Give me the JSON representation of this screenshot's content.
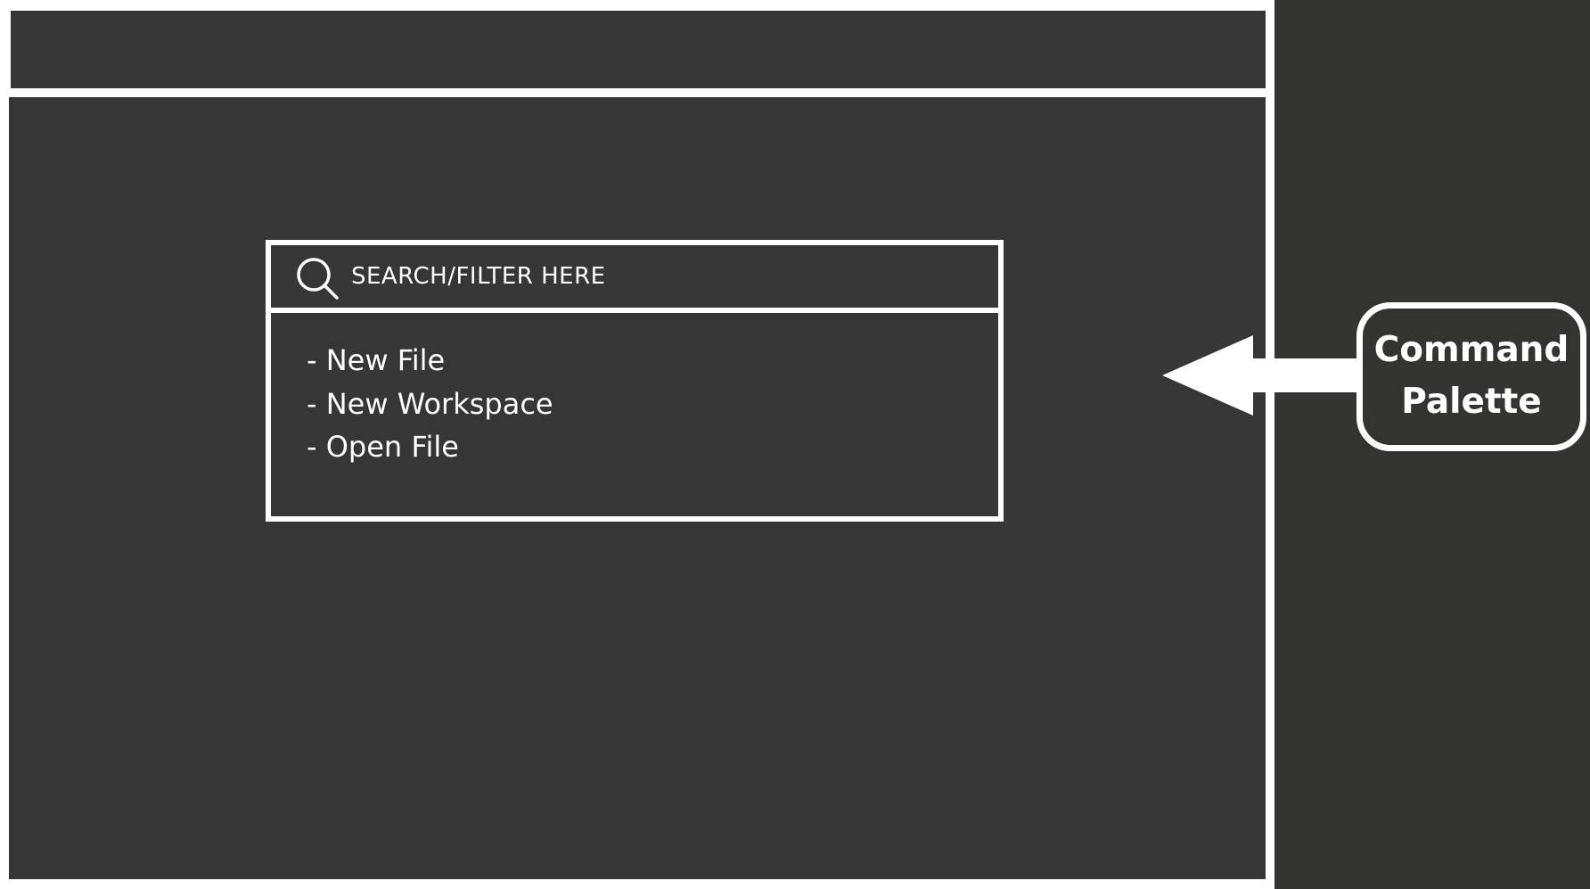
{
  "search": {
    "placeholder": "SEARCH/FILTER HERE"
  },
  "commands": [
    "- New File",
    "- New Workspace",
    "- Open File"
  ],
  "callout": {
    "line1": "Command",
    "line2": "Palette"
  },
  "colors": {
    "background": "#363636",
    "panel": "#333432",
    "stroke": "#ffffff"
  },
  "icons": {
    "search": "search-icon",
    "arrow": "left-arrow"
  }
}
